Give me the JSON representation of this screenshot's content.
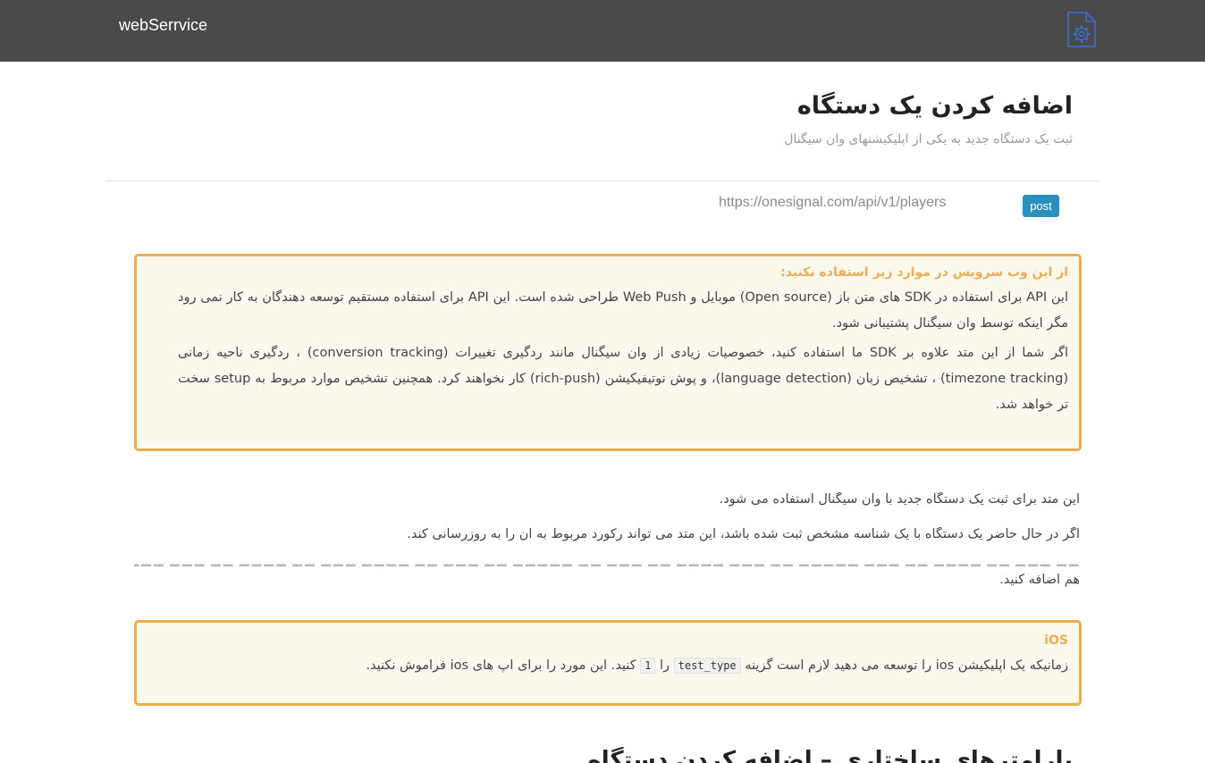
{
  "navbar": {
    "brand": "webSerrvice",
    "icon": "gear-document-icon",
    "icon_color": "#3b6ed8",
    "background": "#4a4a4a"
  },
  "header": {
    "title": "اضافه کردن یک دستگاه",
    "subtitle": "ثبت یک دستگاه جدید به یکی از اپلیکیشنهای وان سیگنال"
  },
  "endpoint": {
    "method": "post",
    "url": "https://onesignal.com/api/v1/players",
    "badge_color": "#2a8fbd"
  },
  "warning_box": {
    "heading": "از این وب سرویس در موارد زیر استفاده نکنید:",
    "paragraph_1": "این API برای استفاده در SDK های متن باز (Open source) موبایل و Web Push طراحی شده است. این API برای استفاده مستقیم توسعه دهندگان به کار نمی رود مگر اینکه توسط وان سیگنال پشتیبانی شود.",
    "paragraph_2": "اگر شما از این متد علاوه بر SDK ما استفاده کنید، خصوصیات زیادی از وان سیگنال مانند ردگیری تغییرات (conversion tracking) ، ردگیری ناحیه زمانی (timezone tracking) ، تشخیص زبان (language detection)، و پوش نوتیفیکیشن (rich-push) کار نخواهند کرد. همچنین تشخیص موارد مربوط به setup سخت تر خواهد شد.",
    "border_color": "#f0ad4e"
  },
  "body": {
    "line_1": "این متد برای ثبت یک دستگاه جدید با وان سیگنال استفاده می شود.",
    "line_2": "اگر در حال حاضر یک دستگاه با یک شناسه مشخص ثبت شده باشد، این متد می تواند رکورد مربوط به آن را به روزرسانی کند.",
    "line_3_end": "هم اضافه کنید."
  },
  "ios_box": {
    "heading": "iOS",
    "text_part_1": "زمانیکه یک اپلیکیشن ios را توسعه می دهید لازم است گزینه",
    "option_code": "test_type",
    "text_part_2": "را",
    "value_code": "1",
    "text_part_3": "کنید. این مورد را برای اپ های ios فراموش نکنید."
  },
  "next_section": {
    "heading": "پارامترهای ساختاری – اضافه کردن دستگاه"
  }
}
